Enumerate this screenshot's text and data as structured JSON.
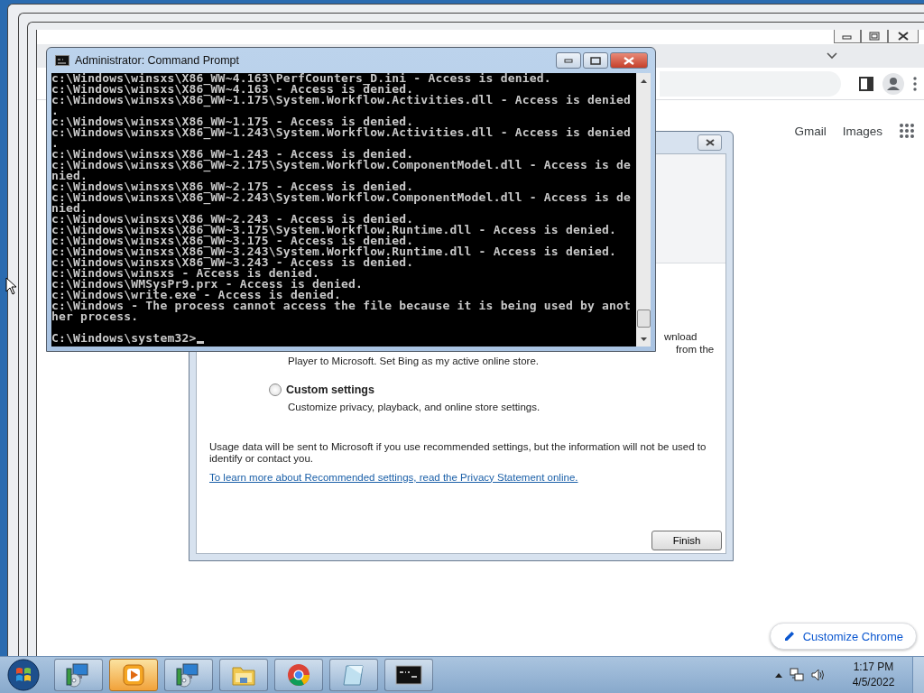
{
  "browser": {
    "links": [
      "Gmail",
      "Images"
    ],
    "customize_button": "Customize Chrome"
  },
  "dialog": {
    "covered_lines": [
      "wnload",
      "from the",
      "Player to Microsoft. Set Bing as my active online store."
    ],
    "option": {
      "label": "Custom settings",
      "selected": false,
      "description": "Customize privacy, playback, and online store settings."
    },
    "notice": "Usage data will be sent to Microsoft if you use recommended settings, but the information will not be used to identify or contact you.",
    "link": "To learn more about Recommended settings, read the Privacy Statement online.",
    "button": "Finish"
  },
  "console": {
    "title": "Administrator: Command Prompt",
    "lines": [
      "c:\\Windows\\winsxs\\X86_WW~4.163\\PerfCounters_D.ini - Access is denied.",
      "c:\\Windows\\winsxs\\X86_WW~4.163 - Access is denied.",
      "c:\\Windows\\winsxs\\X86_WW~1.175\\System.Workflow.Activities.dll - Access is denied",
      ".",
      "c:\\Windows\\winsxs\\X86_WW~1.175 - Access is denied.",
      "c:\\Windows\\winsxs\\X86_WW~1.243\\System.Workflow.Activities.dll - Access is denied",
      ".",
      "c:\\Windows\\winsxs\\X86_WW~1.243 - Access is denied.",
      "c:\\Windows\\winsxs\\X86_WW~2.175\\System.Workflow.ComponentModel.dll - Access is de",
      "nied.",
      "c:\\Windows\\winsxs\\X86_WW~2.175 - Access is denied.",
      "c:\\Windows\\winsxs\\X86_WW~2.243\\System.Workflow.ComponentModel.dll - Access is de",
      "nied.",
      "c:\\Windows\\winsxs\\X86_WW~2.243 - Access is denied.",
      "c:\\Windows\\winsxs\\X86_WW~3.175\\System.Workflow.Runtime.dll - Access is denied.",
      "c:\\Windows\\winsxs\\X86_WW~3.175 - Access is denied.",
      "c:\\Windows\\winsxs\\X86_WW~3.243\\System.Workflow.Runtime.dll - Access is denied.",
      "c:\\Windows\\winsxs\\X86_WW~3.243 - Access is denied.",
      "c:\\Windows\\winsxs - Access is denied.",
      "c:\\Windows\\WMSysPr9.prx - Access is denied.",
      "c:\\Windows\\write.exe - Access is denied.",
      "c:\\Windows - The process cannot access the file because it is being used by anot",
      "her process."
    ],
    "prompt": "C:\\Windows\\system32>"
  },
  "taskbar": {
    "items": [
      {
        "kind": "installer",
        "selected": false
      },
      {
        "kind": "media",
        "selected": true
      },
      {
        "kind": "installer",
        "selected": false
      },
      {
        "kind": "folder",
        "selected": false
      },
      {
        "kind": "browser",
        "selected": false
      },
      {
        "kind": "notepad",
        "selected": false
      },
      {
        "kind": "console",
        "selected": false
      }
    ],
    "time": "1:17 PM",
    "date": "4/5/2022"
  }
}
